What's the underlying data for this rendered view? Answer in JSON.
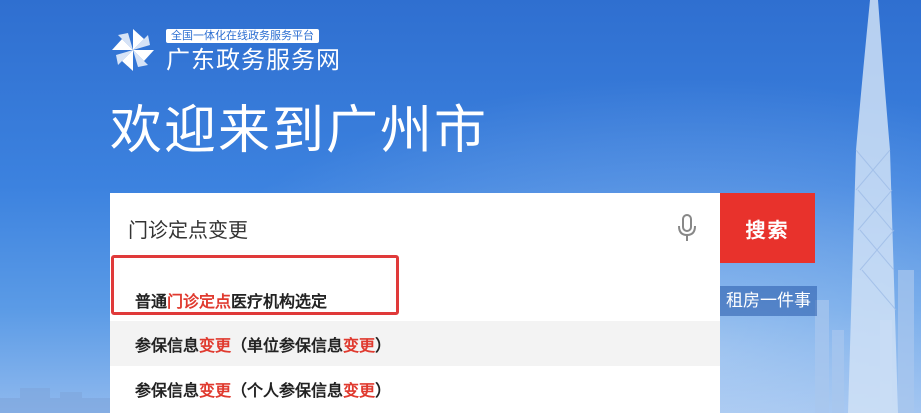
{
  "logo": {
    "tagline": "全国一体化在线政务服务平台",
    "name": "广东政务服务网"
  },
  "welcome": "欢迎来到广州市",
  "search": {
    "value": "门诊定点变更",
    "button_label": "搜索"
  },
  "suggestions": [
    {
      "parts": [
        "普通",
        "门诊定点",
        "医疗机构选定"
      ]
    },
    {
      "parts": [
        "参保信息",
        "变更",
        "（单位参保信息",
        "变更",
        "）"
      ]
    },
    {
      "parts": [
        "参保信息",
        "变更",
        "（个人参保信息",
        "变更",
        "）"
      ]
    }
  ],
  "side_link": "租房一件事",
  "colors": {
    "brand_blue": "#2f6fd0",
    "search_red": "#e8322c",
    "highlight_red": "#e03a2f"
  }
}
